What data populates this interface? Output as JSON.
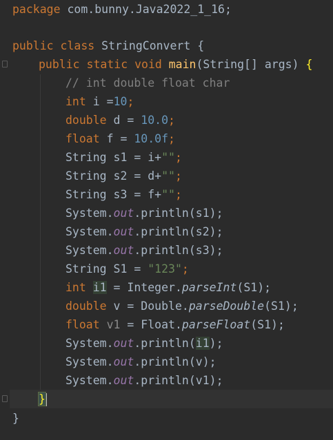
{
  "code": {
    "package_kw": "package",
    "package_name": " com.bunny.Java2022_1_16;",
    "class_kw": "public class",
    "class_name": " StringConvert {",
    "main_kw": "public static void",
    "main_name": "main",
    "main_params": "(String[] args) ",
    "main_brace": "{",
    "comment": "// int double float char",
    "int_kw": "int",
    "i_decl": " i =",
    "i_val": "10",
    "double_kw": "double",
    "d_decl": " d = ",
    "d_val": "10.0",
    "float_kw": "float",
    "f_decl": " f = ",
    "f_val": "10.0f",
    "s1_decl": "String s1 = i+",
    "s2_decl": "String s2 = d+",
    "s3_decl": "String s3 = f+",
    "empty_str": "\"\"",
    "semi": ";",
    "system": "System.",
    "out": "out",
    "println": ".println(",
    "arg_s1": "s1",
    "arg_s2": "s2",
    "arg_s3": "s3",
    "close_call": ");",
    "S1_decl": "String S1 = ",
    "S1_val": "\"123\"",
    "i1_name": "i1",
    "i1_rest": " = Integer.",
    "parseInt": "parseInt",
    "v_decl": " v = Double.",
    "parseDouble": "parseDouble",
    "v1_name": "v1",
    "v1_rest": " = Float.",
    "parseFloat": "parseFloat",
    "arg_S1": "(S1);",
    "arg_i1": "i1",
    "arg_v": "v",
    "arg_v1": "v1",
    "method_close": "}",
    "class_close": "}"
  }
}
